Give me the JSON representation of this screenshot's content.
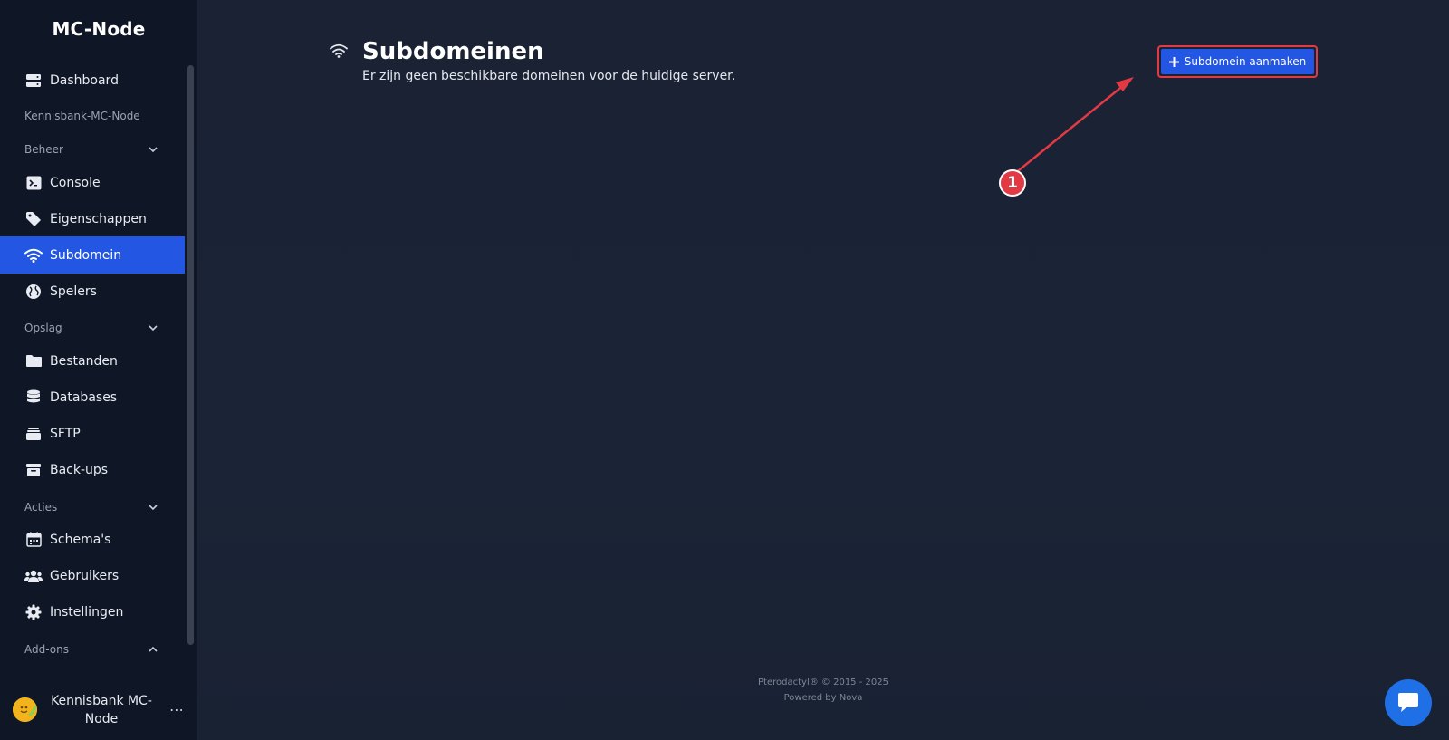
{
  "app": {
    "brand": "MC-Node"
  },
  "sidebar": {
    "items": [
      {
        "label": "Dashboard"
      },
      {
        "label": "Console"
      },
      {
        "label": "Eigenschappen"
      },
      {
        "label": "Subdomein"
      },
      {
        "label": "Spelers"
      },
      {
        "label": "Bestanden"
      },
      {
        "label": "Databases"
      },
      {
        "label": "SFTP"
      },
      {
        "label": "Back-ups"
      },
      {
        "label": "Schema's"
      },
      {
        "label": "Gebruikers"
      },
      {
        "label": "Instellingen"
      }
    ],
    "server_name": "Kennisbank-MC-Node",
    "sections": {
      "beheer": "Beheer",
      "opslag": "Opslag",
      "acties": "Acties",
      "addons": "Add-ons"
    },
    "active_item": "Subdomein",
    "user": {
      "name": "Kennisbank MC-Node",
      "menu": "⋯"
    }
  },
  "main": {
    "title": "Subdomeinen",
    "subtitle": "Er zijn geen beschikbare domeinen voor de huidige server.",
    "create_button": "Subdomein aanmaken",
    "annotation_number": "1"
  },
  "footer": {
    "line1": "Pterodactyl® © 2015 - 2025",
    "line2": "Powered by Nova"
  },
  "colors": {
    "accent": "#2356e3",
    "annotation": "#e23a45",
    "sidebar_bg": "#0f1626",
    "main_bg": "#1a2234",
    "chat": "#1f70e6"
  },
  "icons": {
    "dashboard": "server-icon",
    "console": "terminal-icon",
    "eigenschappen": "tag-icon",
    "subdomein": "wifi-icon",
    "spelers": "globe-icon",
    "bestanden": "folder-icon",
    "databases": "database-icon",
    "sftp": "layers-icon",
    "backups": "archive-icon",
    "schemas": "calendar-icon",
    "gebruikers": "users-icon",
    "instellingen": "gear-icon",
    "chat": "chat-icon"
  }
}
